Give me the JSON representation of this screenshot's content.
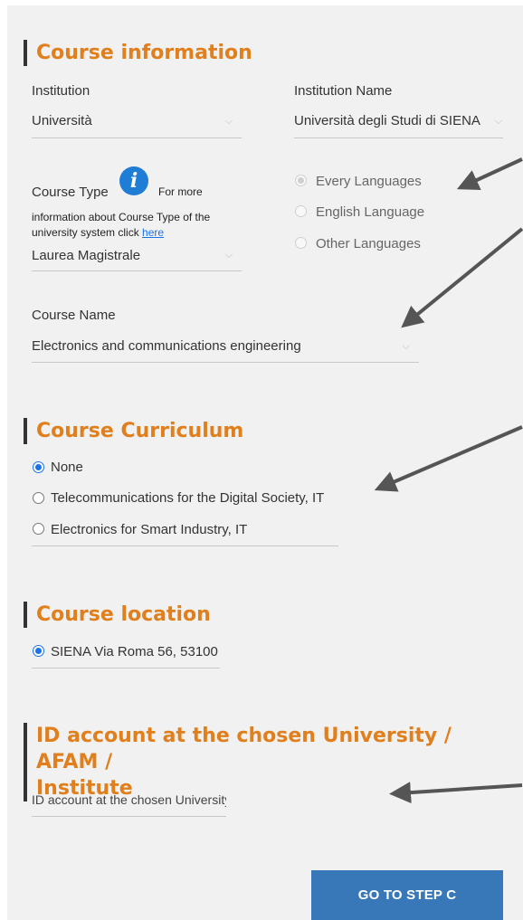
{
  "course_info": {
    "title": "Course information",
    "institution_label": "Institution",
    "institution_value": "Università",
    "institution_name_label": "Institution Name",
    "institution_name_value": "Università degli Studi di SIENA",
    "course_type_label": "Course Type",
    "info_more": "For more",
    "info_line": "information about Course Type of the university system click",
    "info_link": "here",
    "course_type_value": "Laurea Magistrale",
    "languages": [
      {
        "label": "Every Languages",
        "checked": true
      },
      {
        "label": "English Language",
        "checked": false
      },
      {
        "label": "Other Languages",
        "checked": false
      }
    ],
    "course_name_label": "Course Name",
    "course_name_value": "Electronics and communications engineering"
  },
  "curriculum": {
    "title": "Course Curriculum",
    "options": [
      {
        "label": "None",
        "checked": true
      },
      {
        "label": "Telecommunications for the Digital Society, IT",
        "checked": false
      },
      {
        "label": "Electronics for Smart Industry, IT",
        "checked": false
      }
    ]
  },
  "location": {
    "title": "Course location",
    "option": "SIENA Via Roma 56, 53100"
  },
  "account": {
    "title_line1": "ID account at the chosen University / AFAM /",
    "title_line2": "Institute",
    "placeholder": "ID account at the chosen University"
  },
  "button": {
    "label": "GO TO STEP C"
  },
  "icons": {
    "info": "info-icon",
    "chevron": "chevron-down-icon",
    "annotation": "arrow-annotation"
  },
  "colors": {
    "accent": "#e07f1c",
    "button": "#3978b8",
    "radio": "#1a73e8"
  }
}
